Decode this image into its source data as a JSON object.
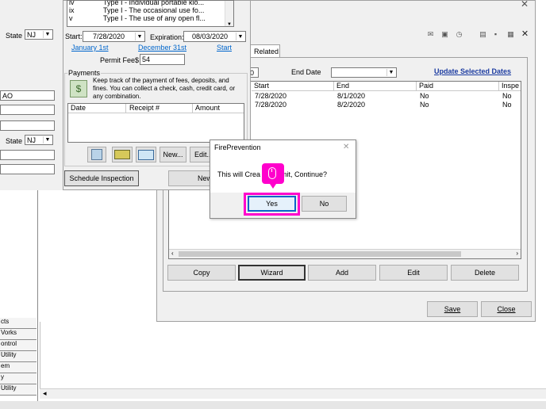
{
  "background_window": {
    "toolbar_icons": [
      "mail-icon",
      "camera-icon",
      "clock-icon",
      "page-icon",
      "save-disk-icon",
      "grid-icon",
      "close-icon"
    ],
    "tab_related": "Related",
    "end_date_label": "End Date",
    "update_dates_link": "Update Selected Dates",
    "table": {
      "headers": [
        "Start",
        "End",
        "Paid",
        "Inspe"
      ],
      "rows": [
        [
          "7/28/2020",
          "8/1/2020",
          "No",
          "No"
        ],
        [
          "7/28/2020",
          "8/2/2020",
          "No",
          "No"
        ]
      ]
    },
    "buttons": {
      "copy": "Copy",
      "wizard": "Wizard",
      "add": "Add",
      "edit": "Edit",
      "delete": "Delete"
    },
    "save_button": "Save",
    "close_button": "Close"
  },
  "left_sidebar": {
    "state_label": "State",
    "state_value": "NJ",
    "field_fragment": "AO",
    "state_label_2": "State",
    "state_value_2": "NJ",
    "items": [
      "cts",
      "Vorks",
      "ontrol",
      "Utility",
      "em",
      "y",
      "Utility"
    ]
  },
  "permit_panel": {
    "type_list": [
      [
        "iv",
        "Type I - Individual portable kio..."
      ],
      [
        "ix",
        "Type I - The occasional use fo..."
      ],
      [
        "v",
        "Type I - The use of any open fl..."
      ]
    ],
    "start_label": "Start:",
    "start_value": "7/28/2020",
    "expiration_label": "Expiration:",
    "expiration_value": "08/03/2020",
    "link_january": "January 1st",
    "link_december": "December 31st",
    "link_start": "Start",
    "permit_fee_label": "Permit Fee",
    "currency": "$",
    "permit_fee_value": "54",
    "payments_group": "Payments",
    "payments_desc": "Keep track of the payment of fees, deposits, and fines. You can collect a check, cash, credit card, or any combination.",
    "payments_headers": [
      "Date",
      "Receipt #",
      "Amount"
    ],
    "new_button": "New...",
    "edit_button": "Edit...",
    "schedule_button": "Schedule Inspection",
    "new_partial": "New"
  },
  "dialog": {
    "title": "FirePrevention",
    "message": "This will Crea",
    "message_end": "ermit, Continue?",
    "yes": "Yes",
    "no": "No",
    "highlight_color": "#ff00cc"
  }
}
